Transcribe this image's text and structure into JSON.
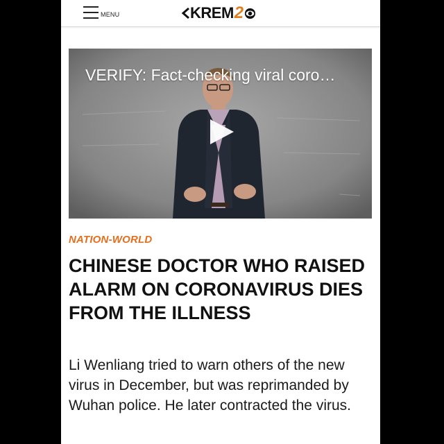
{
  "header": {
    "menu_label": "MENU",
    "logo": {
      "name": "KREM",
      "number": "2",
      "brand_color": "#e0811d"
    }
  },
  "video": {
    "title": "VERIFY: Fact-checking viral coro…",
    "play_icon": "play-icon"
  },
  "article": {
    "category": "NATION-WORLD",
    "category_color": "#e36f1e",
    "headline": "CHINESE DOCTOR WHO RAISED ALARM ON CORONAVIRUS DIES FROM THE ILLNESS",
    "summary": "Li Wenliang tried to warn others of the new virus in December, but was reprimanded by Wuhan police. He later contracted the virus."
  }
}
